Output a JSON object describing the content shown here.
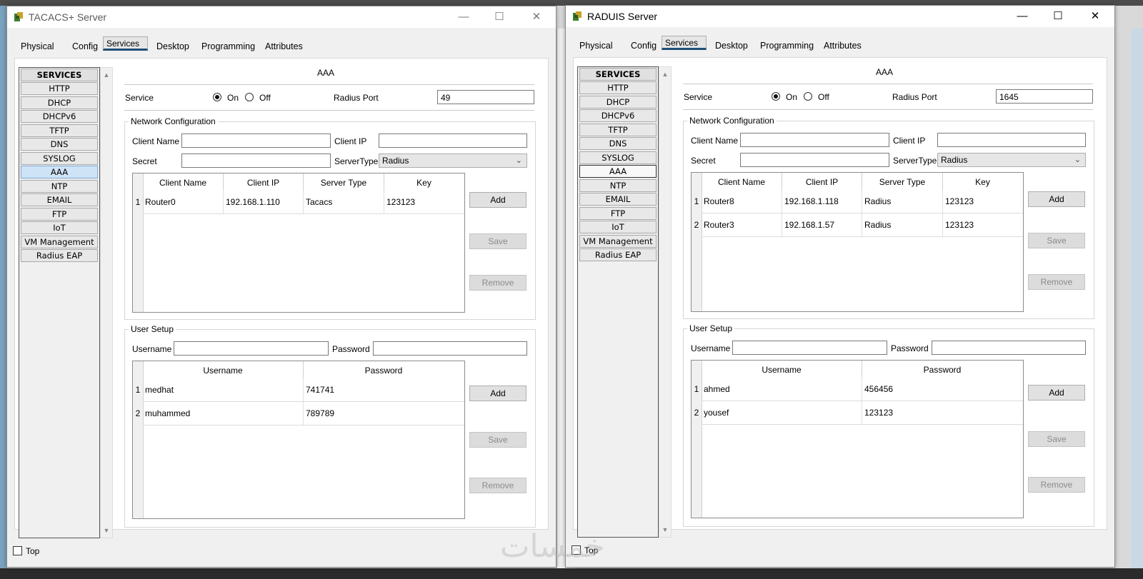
{
  "windows": [
    {
      "id": "tacacs",
      "title": "TACACS+ Server",
      "tabs": [
        "Physical",
        "Config",
        "Services",
        "Desktop",
        "Programming",
        "Attributes"
      ],
      "selected_tab": "Services",
      "services": [
        "SERVICES",
        "HTTP",
        "DHCP",
        "DHCPv6",
        "TFTP",
        "DNS",
        "SYSLOG",
        "AAA",
        "NTP",
        "EMAIL",
        "FTP",
        "IoT",
        "VM Management",
        "Radius EAP"
      ],
      "selected_service": "AAA",
      "section_title": "AAA",
      "service_label": "Service",
      "on_label": "On",
      "off_label": "Off",
      "service_state": "On",
      "radius_port_label": "Radius Port",
      "radius_port": "49",
      "network_config": {
        "title": "Network Configuration",
        "client_name_label": "Client Name",
        "client_name": "",
        "client_ip_label": "Client IP",
        "client_ip": "",
        "secret_label": "Secret",
        "secret": "",
        "server_type_label": "ServerType",
        "server_type": "Radius",
        "columns": [
          "Client Name",
          "Client IP",
          "Server Type",
          "Key"
        ],
        "rows": [
          {
            "n": "1",
            "name": "Router0",
            "ip": "192.168.1.110",
            "type": "Tacacs",
            "key": "123123"
          }
        ],
        "add": "Add",
        "save": "Save",
        "remove": "Remove"
      },
      "user_setup": {
        "title": "User Setup",
        "username_label": "Username",
        "username": "",
        "password_label": "Password",
        "password": "",
        "columns": [
          "Username",
          "Password"
        ],
        "rows": [
          {
            "n": "1",
            "user": "medhat",
            "pass": "741741"
          },
          {
            "n": "2",
            "user": "muhammed",
            "pass": "789789"
          }
        ],
        "add": "Add",
        "save": "Save",
        "remove": "Remove"
      },
      "top_label": "Top"
    },
    {
      "id": "radius",
      "title": "RADUIS Server",
      "tabs": [
        "Physical",
        "Config",
        "Services",
        "Desktop",
        "Programming",
        "Attributes"
      ],
      "selected_tab": "Services",
      "services": [
        "SERVICES",
        "HTTP",
        "DHCP",
        "DHCPv6",
        "TFTP",
        "DNS",
        "SYSLOG",
        "AAA",
        "NTP",
        "EMAIL",
        "FTP",
        "IoT",
        "VM Management",
        "Radius EAP"
      ],
      "selected_service": "AAA",
      "section_title": "AAA",
      "service_label": "Service",
      "on_label": "On",
      "off_label": "Off",
      "service_state": "On",
      "radius_port_label": "Radius Port",
      "radius_port": "1645",
      "network_config": {
        "title": "Network Configuration",
        "client_name_label": "Client Name",
        "client_name": "",
        "client_ip_label": "Client IP",
        "client_ip": "",
        "secret_label": "Secret",
        "secret": "",
        "server_type_label": "ServerType",
        "server_type": "Radius",
        "columns": [
          "Client Name",
          "Client IP",
          "Server Type",
          "Key"
        ],
        "rows": [
          {
            "n": "1",
            "name": "Router8",
            "ip": "192.168.1.118",
            "type": "Radius",
            "key": "123123"
          },
          {
            "n": "2",
            "name": "Router3",
            "ip": "192.168.1.57",
            "type": "Radius",
            "key": "123123"
          }
        ],
        "add": "Add",
        "save": "Save",
        "remove": "Remove"
      },
      "user_setup": {
        "title": "User Setup",
        "username_label": "Username",
        "username": "",
        "password_label": "Password",
        "password": "",
        "columns": [
          "Username",
          "Password"
        ],
        "rows": [
          {
            "n": "1",
            "user": "ahmed",
            "pass": "456456"
          },
          {
            "n": "2",
            "user": "yousef",
            "pass": "123123"
          }
        ],
        "add": "Add",
        "save": "Save",
        "remove": "Remove"
      },
      "top_label": "Top"
    }
  ],
  "icons": [
    "app-icon",
    "minimize-icon",
    "maximize-icon",
    "close-icon",
    "chevron-down-icon",
    "scroll-up-icon",
    "scroll-down-icon"
  ],
  "watermark": "خمسات"
}
